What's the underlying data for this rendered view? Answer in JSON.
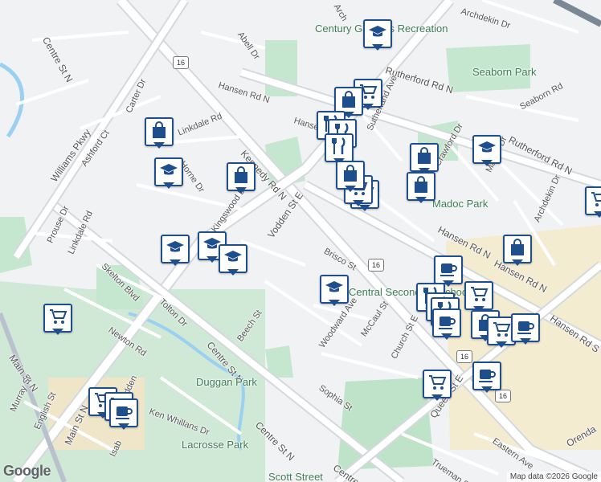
{
  "map": {
    "attribution": "Map data ©2026 Google",
    "logo": "Google",
    "road_labels": [
      "Archdekin Dr",
      "Rutherford Rd N",
      "Seaborn Park",
      "Seaborn Rd",
      "Rutherford Rd N",
      "Hansen Rd N",
      "Abell Dr",
      "Hanse",
      "Kennedy Rd N",
      "Vodden St E",
      "Linkdale Rd",
      "Horne Dr",
      "Kingswood Dr",
      "Centre St N",
      "Williams Pkwy",
      "Carter Dr",
      "Ashford Ct",
      "Prouse Dr",
      "Linkdale Rd",
      "Skelton Blvd",
      "Tolton Dr",
      "Newton Rd",
      "Main St N",
      "Brisco St",
      "Woodward Ave",
      "McCaul St",
      "Church St E",
      "Sophia St",
      "Beech St",
      "Centre St N",
      "Centre St N",
      "Hansen Rd N",
      "Hansen Rd N",
      "Hansen Rd S",
      "Sutherland Ave",
      "Crawford Dr",
      "Madoc Dr",
      "Archdekin Dr",
      "Queen St E",
      "Trueman St",
      "Eastern Ave",
      "Orenda",
      "Ken Whillans Dr",
      "Murray St",
      "English St",
      "Main St N",
      "Isab",
      "Centre St",
      "Vodden",
      "Arch"
    ],
    "places": [
      "Century Gardens Recreation",
      "Madoc Park",
      "Duggan Park",
      "Lacrosse Park",
      "Scott Street",
      "Central Secondary School"
    ],
    "route_shields": [
      "16",
      "16",
      "16",
      "16"
    ],
    "pins": [
      {
        "icon": "school-icon"
      },
      {
        "icon": "cart-icon"
      },
      {
        "icon": "bag-icon"
      },
      {
        "icon": "restaurant-icon"
      },
      {
        "icon": "restaurant-icon"
      },
      {
        "icon": "restaurant-icon"
      },
      {
        "icon": "bag-icon"
      },
      {
        "icon": "cart-icon"
      },
      {
        "icon": "cart-icon"
      },
      {
        "icon": "bag-icon"
      },
      {
        "icon": "bag-icon"
      },
      {
        "icon": "school-icon"
      },
      {
        "icon": "bag-icon"
      },
      {
        "icon": "school-icon"
      },
      {
        "icon": "bag-icon"
      },
      {
        "icon": "school-icon"
      },
      {
        "icon": "school-icon"
      },
      {
        "icon": "school-icon"
      },
      {
        "icon": "school-icon"
      },
      {
        "icon": "bag-icon"
      },
      {
        "icon": "coffee-icon"
      },
      {
        "icon": "restaurant-icon"
      },
      {
        "icon": "cart-icon"
      },
      {
        "icon": "restaurant-icon"
      },
      {
        "icon": "restaurant-icon"
      },
      {
        "icon": "coffee-icon"
      },
      {
        "icon": "bag-icon"
      },
      {
        "icon": "cart-icon"
      },
      {
        "icon": "coffee-icon"
      },
      {
        "icon": "cart-icon"
      },
      {
        "icon": "cart-icon"
      },
      {
        "icon": "coffee-icon"
      },
      {
        "icon": "cart-icon"
      },
      {
        "icon": "cart-icon"
      },
      {
        "icon": "coffee-icon"
      },
      {
        "icon": "cart-icon"
      }
    ]
  }
}
